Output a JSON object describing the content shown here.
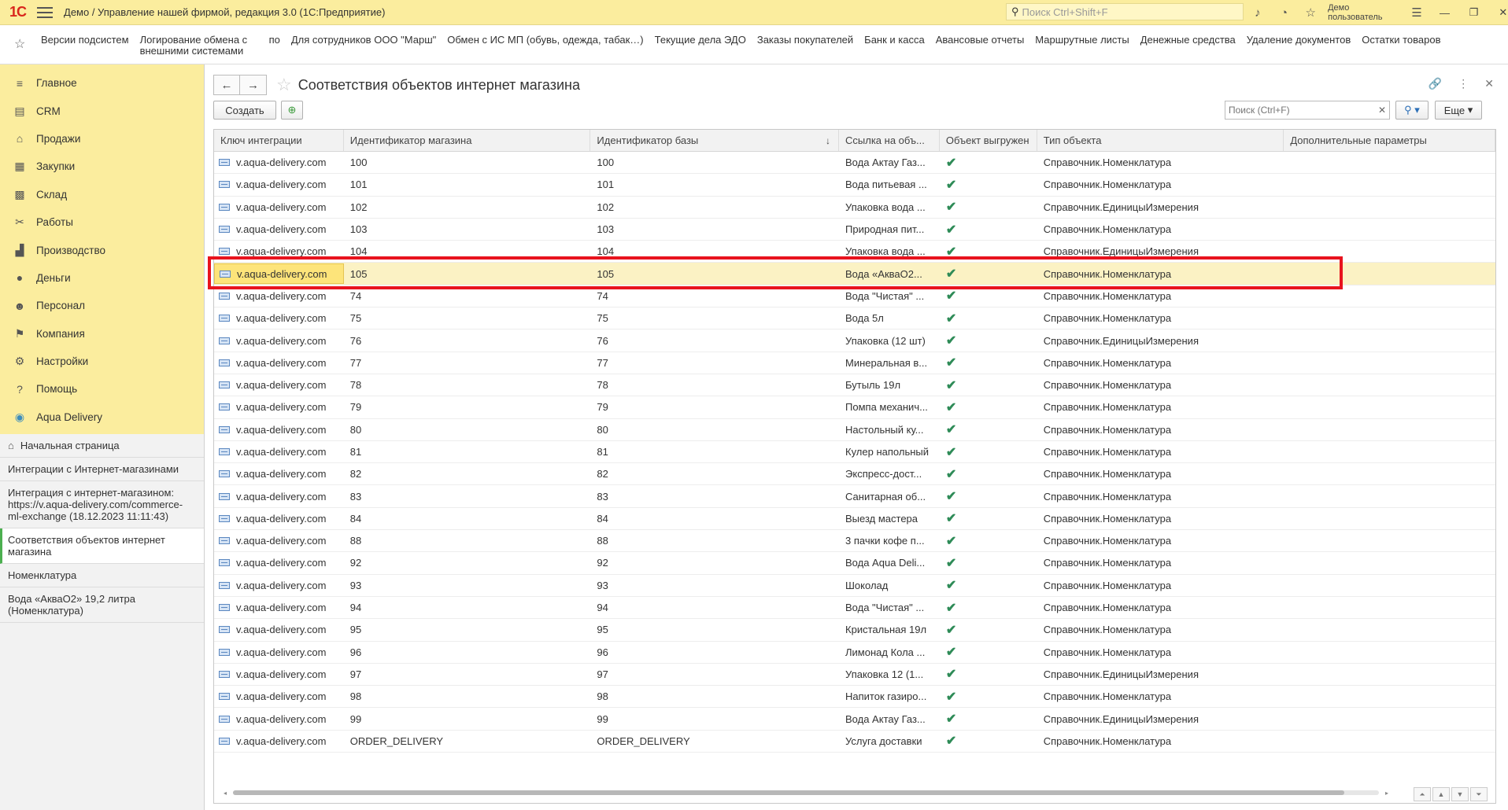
{
  "titlebar": {
    "logo": "1С",
    "title": "Демо / Управление нашей фирмой, редакция 3.0  (1С:Предприятие)",
    "search_placeholder": "Поиск Ctrl+Shift+F",
    "user": "Демо пользователь"
  },
  "favorites": [
    "Версии подсистем",
    "Логирование обмена с внешними системами",
    "по",
    "Для сотрудников ООО \"Марш\"",
    "Обмен с ИС МП (обувь, одежда, табак…)",
    "Текущие дела ЭДО",
    "Заказы покупателей",
    "Банк и касса",
    "Авансовые отчеты",
    "Маршрутные листы",
    "Денежные средства",
    "Удаление документов",
    "Остатки товаров"
  ],
  "sections": [
    {
      "label": "Главное",
      "icon": "≡"
    },
    {
      "label": "CRM",
      "icon": "▤"
    },
    {
      "label": "Продажи",
      "icon": "⌂"
    },
    {
      "label": "Закупки",
      "icon": "▦"
    },
    {
      "label": "Склад",
      "icon": "▩"
    },
    {
      "label": "Работы",
      "icon": "✂"
    },
    {
      "label": "Производство",
      "icon": "▟"
    },
    {
      "label": "Деньги",
      "icon": "●"
    },
    {
      "label": "Персонал",
      "icon": "☻"
    },
    {
      "label": "Компания",
      "icon": "⚑"
    },
    {
      "label": "Настройки",
      "icon": "⚙"
    },
    {
      "label": "Помощь",
      "icon": "?"
    },
    {
      "label": "Aqua Delivery",
      "icon": "◉"
    }
  ],
  "open_windows": {
    "home": "Начальная страница",
    "items": [
      "Интеграции с Интернет-магазинами",
      "Интеграция с интернет-магазином: https://v.aqua-delivery.com/commerce-ml-exchange (18.12.2023 11:11:43)",
      "Соответствия объектов интернет магазина",
      "Номенклатура",
      "Вода «АкваО2» 19,2 литра (Номенклатура)"
    ]
  },
  "form": {
    "title": "Соответствия объектов интернет магазина",
    "create_label": "Создать",
    "search_placeholder": "Поиск (Ctrl+F)",
    "more_label": "Еще",
    "sort_indicator": "↓"
  },
  "table": {
    "columns": [
      "Ключ интеграции",
      "Идентификатор магазина",
      "Идентификатор базы",
      "Ссылка на объ...",
      "Объект выгружен",
      "Тип объекта",
      "Дополнительные параметры"
    ],
    "check_mark": "✔",
    "rows": [
      [
        "v.aqua-delivery.com",
        "100",
        "100",
        "Вода Актау Газ...",
        "Справочник.Номенклатура"
      ],
      [
        "v.aqua-delivery.com",
        "101",
        "101",
        "Вода питьевая ...",
        "Справочник.Номенклатура"
      ],
      [
        "v.aqua-delivery.com",
        "102",
        "102",
        "Упаковка вода ...",
        "Справочник.ЕдиницыИзмерения"
      ],
      [
        "v.aqua-delivery.com",
        "103",
        "103",
        "Природная пит...",
        "Справочник.Номенклатура"
      ],
      [
        "v.aqua-delivery.com",
        "104",
        "104",
        "Упаковка вода ...",
        "Справочник.ЕдиницыИзмерения"
      ],
      [
        "v.aqua-delivery.com",
        "105",
        "105",
        "Вода «АкваО2...",
        "Справочник.Номенклатура"
      ],
      [
        "v.aqua-delivery.com",
        "74",
        "74",
        "Вода \"Чистая\" ...",
        "Справочник.Номенклатура"
      ],
      [
        "v.aqua-delivery.com",
        "75",
        "75",
        "Вода 5л",
        "Справочник.Номенклатура"
      ],
      [
        "v.aqua-delivery.com",
        "76",
        "76",
        "Упаковка (12 шт)",
        "Справочник.ЕдиницыИзмерения"
      ],
      [
        "v.aqua-delivery.com",
        "77",
        "77",
        "Минеральная в...",
        "Справочник.Номенклатура"
      ],
      [
        "v.aqua-delivery.com",
        "78",
        "78",
        "Бутыль 19л",
        "Справочник.Номенклатура"
      ],
      [
        "v.aqua-delivery.com",
        "79",
        "79",
        "Помпа механич...",
        "Справочник.Номенклатура"
      ],
      [
        "v.aqua-delivery.com",
        "80",
        "80",
        "Настольный ку...",
        "Справочник.Номенклатура"
      ],
      [
        "v.aqua-delivery.com",
        "81",
        "81",
        "Кулер напольный",
        "Справочник.Номенклатура"
      ],
      [
        "v.aqua-delivery.com",
        "82",
        "82",
        "Экспресс-дост...",
        "Справочник.Номенклатура"
      ],
      [
        "v.aqua-delivery.com",
        "83",
        "83",
        "Санитарная об...",
        "Справочник.Номенклатура"
      ],
      [
        "v.aqua-delivery.com",
        "84",
        "84",
        "Выезд мастера",
        "Справочник.Номенклатура"
      ],
      [
        "v.aqua-delivery.com",
        "88",
        "88",
        "3 пачки кофе п...",
        "Справочник.Номенклатура"
      ],
      [
        "v.aqua-delivery.com",
        "92",
        "92",
        "Вода Aqua Deli...",
        "Справочник.Номенклатура"
      ],
      [
        "v.aqua-delivery.com",
        "93",
        "93",
        "Шоколад",
        "Справочник.Номенклатура"
      ],
      [
        "v.aqua-delivery.com",
        "94",
        "94",
        "Вода \"Чистая\" ...",
        "Справочник.Номенклатура"
      ],
      [
        "v.aqua-delivery.com",
        "95",
        "95",
        "Кристальная 19л",
        "Справочник.Номенклатура"
      ],
      [
        "v.aqua-delivery.com",
        "96",
        "96",
        "Лимонад Кола ...",
        "Справочник.Номенклатура"
      ],
      [
        "v.aqua-delivery.com",
        "97",
        "97",
        "Упаковка 12 (1...",
        "Справочник.ЕдиницыИзмерения"
      ],
      [
        "v.aqua-delivery.com",
        "98",
        "98",
        "Напиток газиро...",
        "Справочник.Номенклатура"
      ],
      [
        "v.aqua-delivery.com",
        "99",
        "99",
        "Вода Актау Газ...",
        "Справочник.ЕдиницыИзмерения"
      ],
      [
        "v.aqua-delivery.com",
        "ORDER_DELIVERY",
        "ORDER_DELIVERY",
        "Услуга доставки",
        "Справочник.Номенклатура"
      ]
    ],
    "selected_row_index": 5
  },
  "colors": {
    "accent_yellow": "#fbed9e",
    "selected_row": "#fbf2c4",
    "highlight_frame": "#e8131e",
    "check_green": "#2e8b57"
  }
}
